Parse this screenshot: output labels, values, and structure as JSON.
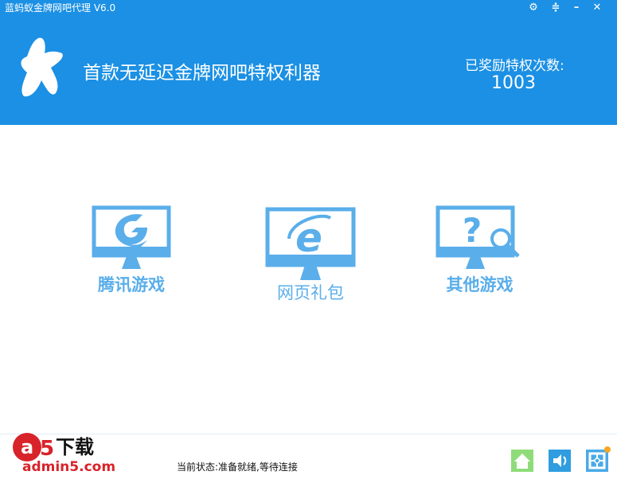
{
  "window": {
    "title": "蓝蚂蚁金牌网吧代理 V6.0"
  },
  "header": {
    "slogan": "首款无延迟金牌网吧特权利器",
    "count_label": "已奖励特权次数:",
    "count": "1003"
  },
  "tiles": [
    {
      "label": "腾讯游戏",
      "icon": "tencent-games-icon"
    },
    {
      "label": "网页礼包",
      "icon": "ie-browser-icon"
    },
    {
      "label": "其他游戏",
      "icon": "question-search-icon"
    }
  ],
  "status": {
    "text": "当前状态:准备就绪,等待连接"
  },
  "watermark": {
    "text": "a5下载 admin5.com"
  },
  "colors": {
    "brand": "#1b90e4",
    "tile": "#5aaeea"
  }
}
